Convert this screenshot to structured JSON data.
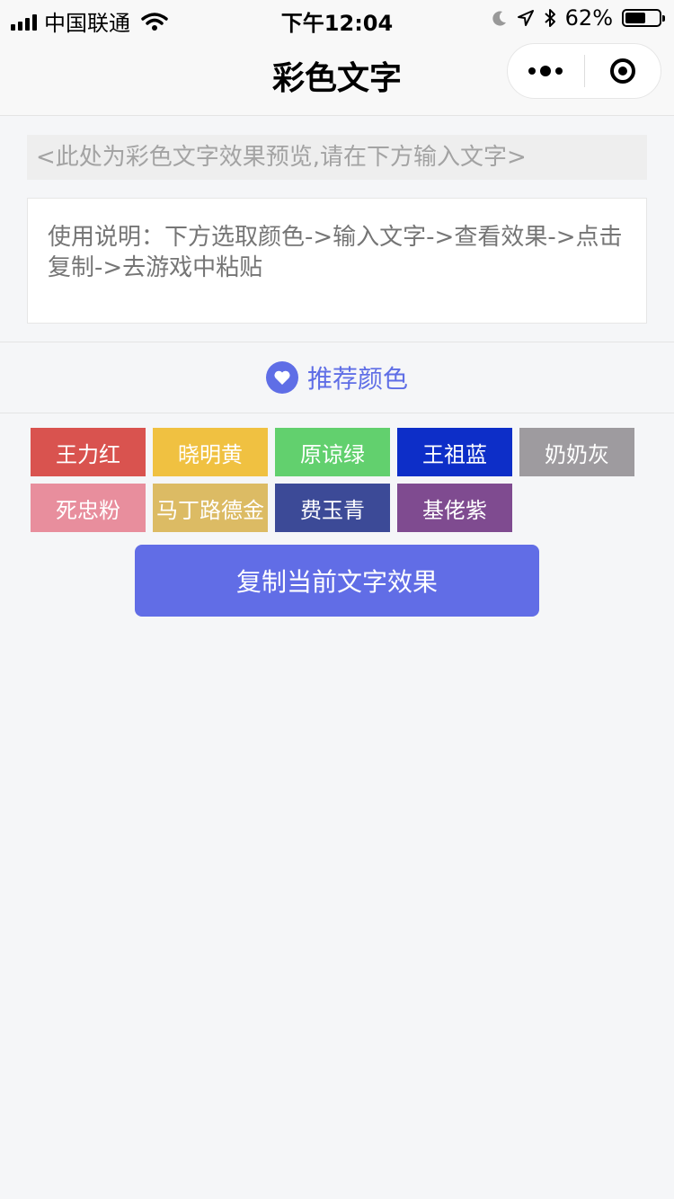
{
  "status_bar": {
    "carrier": "中国联通",
    "time": "下午12:04",
    "battery_percent": "62%",
    "battery_level": 0.62,
    "icons": [
      "signal-icon",
      "wifi-icon",
      "moon-icon",
      "location-icon",
      "bluetooth-icon",
      "battery-icon"
    ]
  },
  "nav": {
    "title": "彩色文字",
    "capsule_icons": [
      "more-icon",
      "close-target-icon"
    ]
  },
  "preview": {
    "text": "<此处为彩色文字效果预览,请在下方输入文字>"
  },
  "input": {
    "placeholder": "使用说明：下方选取颜色->输入文字->查看效果->点击复制->去游戏中粘贴",
    "value": ""
  },
  "section": {
    "title": "推荐颜色",
    "icon": "heart-icon"
  },
  "colors": [
    {
      "label": "王力红",
      "color": "#d9534f"
    },
    {
      "label": "晓明黄",
      "color": "#f0c141"
    },
    {
      "label": "原谅绿",
      "color": "#62d06e"
    },
    {
      "label": "王祖蓝",
      "color": "#0d2ec8"
    },
    {
      "label": "奶奶灰",
      "color": "#9e9b9f"
    },
    {
      "label": "死忠粉",
      "color": "#e88e9d"
    },
    {
      "label": "马丁路德金",
      "color": "#dcbb64"
    },
    {
      "label": "费玉青",
      "color": "#3c4a97"
    },
    {
      "label": "基佬紫",
      "color": "#7f4b90"
    }
  ],
  "copy_button": {
    "label": "复制当前文字效果"
  },
  "theme": {
    "accent": "#616de6"
  }
}
